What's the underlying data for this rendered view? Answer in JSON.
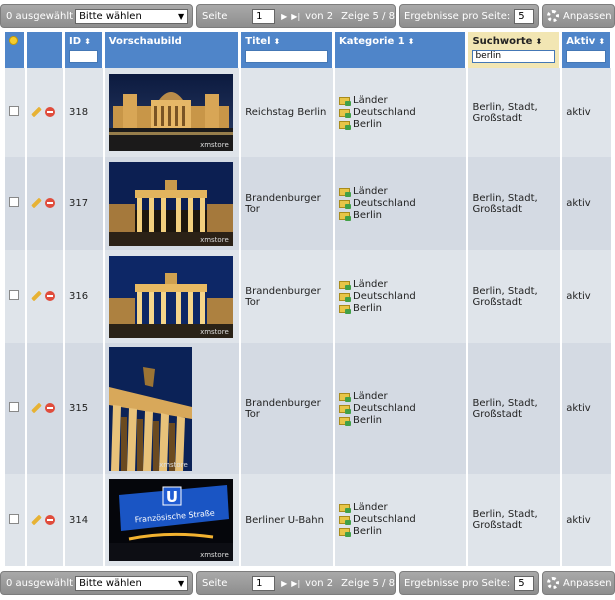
{
  "toolbar": {
    "selected_count": "0 ausgewählt",
    "bulk_action": "Bitte wählen",
    "page_label": "Seite",
    "page_value": "1",
    "page_of": "von 2",
    "showing": "Zeige 5 / 8",
    "per_page_label": "Ergebnisse pro Seite:",
    "per_page_value": "5",
    "customize_label": "Anpassen"
  },
  "columns": {
    "id": "ID",
    "preview": "Vorschaubild",
    "title": "Titel",
    "category": "Kategorie 1",
    "keywords": "Suchworte",
    "active": "Aktiv"
  },
  "filters": {
    "keywords_value": "berlin"
  },
  "watermark": "xmstore",
  "rows": [
    {
      "id": "318",
      "title": "Reichstag Berlin",
      "cat": [
        "Länder",
        "Deutschland",
        "Berlin"
      ],
      "keywords": "Berlin, Stadt, Großstadt",
      "status": "aktiv"
    },
    {
      "id": "317",
      "title": "Brandenburger Tor",
      "cat": [
        "Länder",
        "Deutschland",
        "Berlin"
      ],
      "keywords": "Berlin, Stadt, Großstadt",
      "status": "aktiv"
    },
    {
      "id": "316",
      "title": "Brandenburger Tor",
      "cat": [
        "Länder",
        "Deutschland",
        "Berlin"
      ],
      "keywords": "Berlin, Stadt, Großstadt",
      "status": "aktiv"
    },
    {
      "id": "315",
      "title": "Brandenburger Tor",
      "cat": [
        "Länder",
        "Deutschland",
        "Berlin"
      ],
      "keywords": "Berlin, Stadt, Großstadt",
      "status": "aktiv"
    },
    {
      "id": "314",
      "title": "Berliner U-Bahn",
      "cat": [
        "Länder",
        "Deutschland",
        "Berlin"
      ],
      "keywords": "Berlin, Stadt, Großstadt",
      "status": "aktiv"
    }
  ],
  "ubahn_sign": {
    "letter": "U",
    "text": "Französische Straße"
  }
}
